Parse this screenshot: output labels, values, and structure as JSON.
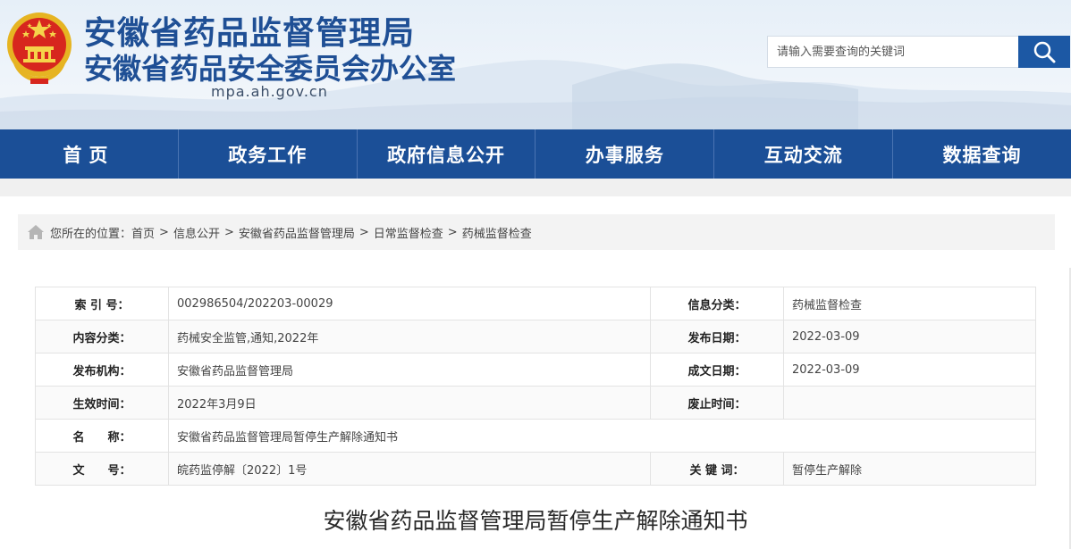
{
  "header": {
    "title_main": "安徽省药品监督管理局",
    "title_sub": "安徽省药品安全委员会办公室",
    "domain": "mpa.ah.gov.cn",
    "emblem_icon": "national-emblem-icon",
    "brand_color": "#1f4f95"
  },
  "search": {
    "placeholder": "请输入需要查询的关键词",
    "button_icon": "search-icon",
    "button_color": "#1c58a4"
  },
  "nav": {
    "color": "#1b4f97",
    "items": [
      {
        "label": "首页"
      },
      {
        "label": "政务工作"
      },
      {
        "label": "政府信息公开"
      },
      {
        "label": "办事服务"
      },
      {
        "label": "互动交流"
      },
      {
        "label": "数据查询"
      }
    ]
  },
  "breadcrumb": {
    "icon": "home-icon",
    "prefix": "您所在的位置：",
    "items": [
      "首页",
      "信息公开",
      "安徽省药品监督管理局",
      "日常监督检查",
      "药械监督检查"
    ],
    "separator": ">"
  },
  "info": {
    "index_no_label": "索 引 号：",
    "index_no": "002986504/202203-00029",
    "info_category_label": "信息分类：",
    "info_category": "药械监督检查",
    "content_category_label": "内容分类：",
    "content_category": "药械安全监管,通知,2022年",
    "publish_date_label": "发布日期：",
    "publish_date": "2022-03-09",
    "issuer_label": "发布机构：",
    "issuer": "安徽省药品监督管理局",
    "written_date_label": "成文日期：",
    "written_date": "2022-03-09",
    "effective_label": "生效时间：",
    "effective": "2022年3月9日",
    "repeal_label": "废止时间：",
    "repeal": "",
    "name_label": "名　　称：",
    "name": "安徽省药品监督管理局暂停生产解除通知书",
    "doc_no_label": "文　　号：",
    "doc_no": "皖药监停解〔2022〕1号",
    "keywords_label": "关 键 词：",
    "keywords": "暂停生产解除"
  },
  "document": {
    "title": "安徽省药品监督管理局暂停生产解除通知书"
  }
}
